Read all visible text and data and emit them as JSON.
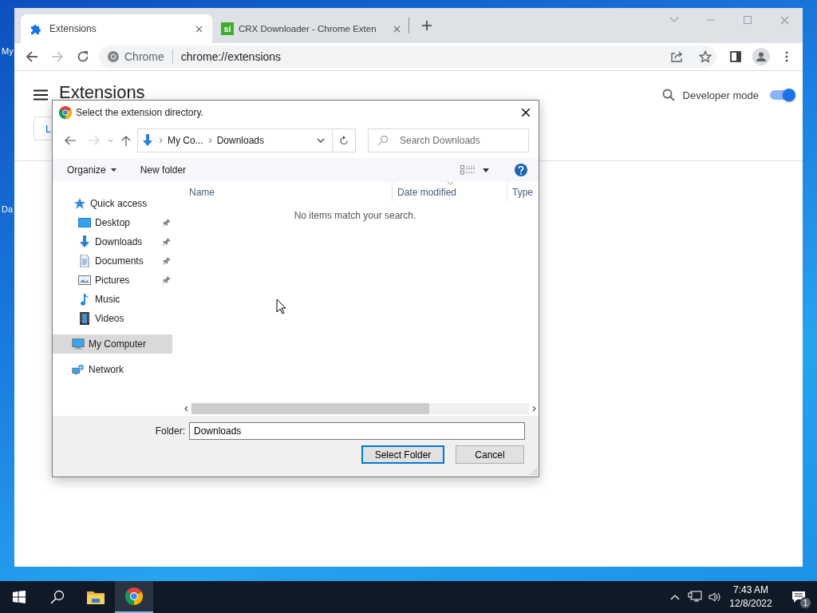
{
  "desktop": {
    "icon_labels": [
      "My",
      "Da"
    ]
  },
  "browser": {
    "tabs": [
      {
        "title": "Extensions",
        "selected": true
      },
      {
        "title": "CRX Downloader - Chrome Exten",
        "icon_text": "si",
        "selected": false
      }
    ],
    "forward_disabled": true,
    "omnibox": {
      "chip": "Chrome",
      "url": "chrome://extensions"
    },
    "page": {
      "title": "Extensions",
      "developer_mode": {
        "label": "Developer mode",
        "on": true
      },
      "button_label": "L"
    }
  },
  "dialog": {
    "title": "Select the extension directory.",
    "forward_disabled": true,
    "breadcrumb": [
      "My Co...",
      "Downloads"
    ],
    "search": {
      "placeholder": "Search Downloads"
    },
    "commands": [
      "Organize",
      "New folder"
    ],
    "nav": [
      {
        "label": "Quick access",
        "selected": false,
        "children": [
          {
            "label": "Desktop",
            "pinned": true,
            "selected": false
          },
          {
            "label": "Downloads",
            "pinned": true,
            "selected": false
          },
          {
            "label": "Documents",
            "pinned": true,
            "selected": false
          },
          {
            "label": "Pictures",
            "pinned": true,
            "selected": false
          },
          {
            "label": "Music",
            "pinned": false,
            "selected": false
          },
          {
            "label": "Videos",
            "pinned": false,
            "selected": false
          }
        ]
      },
      {
        "label": "My Computer",
        "selected": true
      },
      {
        "label": "Network",
        "selected": false
      }
    ],
    "columns": [
      "Name",
      "Date modified",
      "Type"
    ],
    "empty_message": "No items match your search.",
    "folder": {
      "label": "Folder:",
      "value": "Downloads"
    },
    "buttons": [
      {
        "label": "Select Folder",
        "default": true
      },
      {
        "label": "Cancel",
        "default": false
      }
    ]
  },
  "taskbar": {
    "apps": [
      {
        "selected": false
      },
      {
        "selected": true
      }
    ],
    "time": "7:43 AM",
    "date": "12/8/2022",
    "notification_count": "1"
  }
}
